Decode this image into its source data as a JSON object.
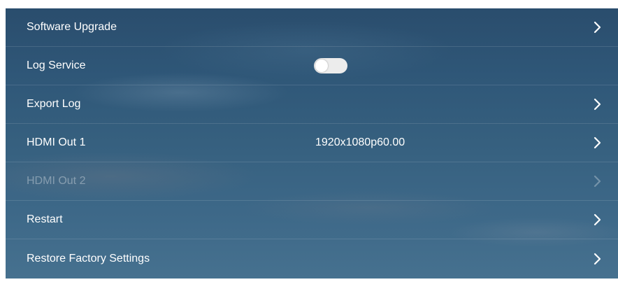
{
  "settings": {
    "rows": [
      {
        "label": "Software Upgrade",
        "value": "",
        "has_chevron": true,
        "enabled": true
      },
      {
        "label": "Log Service",
        "value": "",
        "toggle": false,
        "enabled": true
      },
      {
        "label": "Export Log",
        "value": "",
        "has_chevron": true,
        "enabled": true
      },
      {
        "label": "HDMI Out 1",
        "value": "1920x1080p60.00",
        "has_chevron": true,
        "enabled": true
      },
      {
        "label": "HDMI Out 2",
        "value": "",
        "has_chevron": true,
        "enabled": false
      },
      {
        "label": "Restart",
        "value": "",
        "has_chevron": true,
        "enabled": true
      },
      {
        "label": "Restore Factory Settings",
        "value": "",
        "has_chevron": true,
        "enabled": true
      }
    ]
  },
  "icons": {
    "chevron": "chevron-right-icon"
  },
  "colors": {
    "text": "#ffffff",
    "disabled_text": "rgba(255,255,255,0.35)",
    "toggle_off": "#ececec"
  }
}
